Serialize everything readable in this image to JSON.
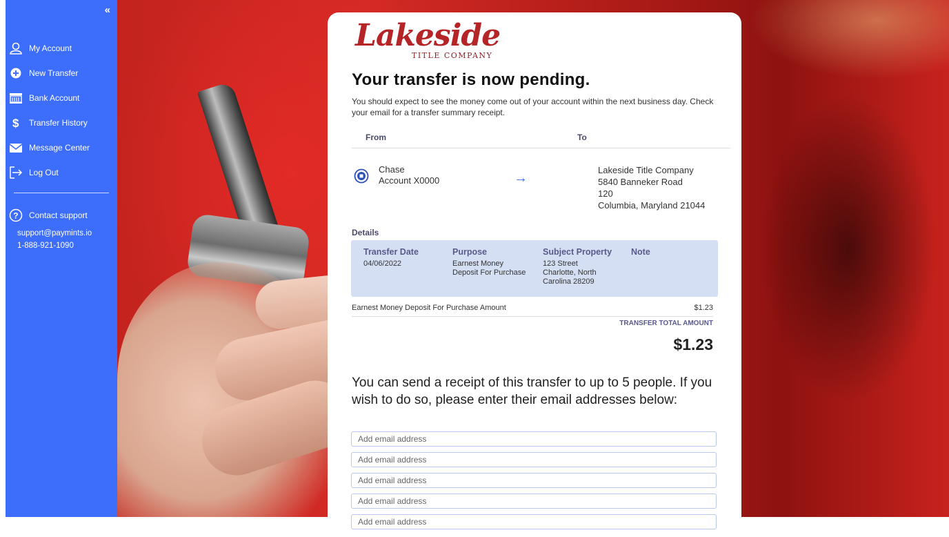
{
  "sidebar": {
    "collapse_icon": "«",
    "items": [
      {
        "label": "My Account",
        "icon": "user-icon"
      },
      {
        "label": "New Transfer",
        "icon": "plus-circle-icon"
      },
      {
        "label": "Bank Account",
        "icon": "bank-icon"
      },
      {
        "label": "Transfer History",
        "icon": "dollar-icon"
      },
      {
        "label": "Message Center",
        "icon": "envelope-icon"
      },
      {
        "label": "Log Out",
        "icon": "logout-icon"
      }
    ],
    "support": {
      "label": "Contact support",
      "email": "support@paymints.io",
      "phone": "1-888-921-1090"
    },
    "accent": "#3d6dfb"
  },
  "logo": {
    "word": "Lakeside",
    "sub": "TITLE COMPANY"
  },
  "main": {
    "title": "Your transfer is now pending.",
    "intro": "You should expect to see the money come out of your account within the next business day. Check your email for a transfer summary receipt.",
    "from_label": "From",
    "to_label": "To",
    "from": {
      "bank": "Chase",
      "account": "Account X0000"
    },
    "arrow": "→",
    "to": {
      "name": "Lakeside Title Company",
      "street": "5840 Banneker Road",
      "unit": "120",
      "city": "Columbia, Maryland 21044"
    },
    "details_label": "Details",
    "details": [
      {
        "header": "Transfer Date",
        "lines": [
          "04/06/2022"
        ]
      },
      {
        "header": "Purpose",
        "lines": [
          "Earnest Money",
          "Deposit For Purchase"
        ]
      },
      {
        "header": "Subject Property",
        "lines": [
          "123 Street",
          "Charlotte, North",
          "Carolina 28209"
        ]
      },
      {
        "header": "Note",
        "lines": []
      }
    ],
    "amount_label": "Earnest Money Deposit For Purchase Amount",
    "amount_value": "$1.23",
    "total_label": "TRANSFER TOTAL AMOUNT",
    "total_value": "$1.23",
    "receipt_text": "You can send a receipt of this transfer to up to 5 people. If you wish to do so, please enter their email addresses below:",
    "email_placeholder": "Add email address"
  }
}
